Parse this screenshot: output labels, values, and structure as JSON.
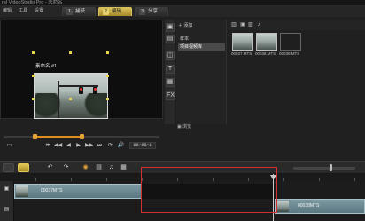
{
  "app": {
    "title": "rel VideoStudio Pro - 未命名"
  },
  "menu": [
    "编辑",
    "工具",
    "设置"
  ],
  "steps": [
    {
      "num": "1",
      "label": "捕获",
      "active": false
    },
    {
      "num": "2",
      "label": "编辑",
      "active": true
    },
    {
      "num": "3",
      "label": "分享",
      "active": false
    }
  ],
  "preview": {
    "clip_label": "素命名 #1"
  },
  "player": {
    "timecode": "00:00:0",
    "buttons": [
      "⏮",
      "◀◀",
      "◀",
      "▶",
      "▶▶",
      "⏭",
      "⟳",
      "🔊"
    ]
  },
  "library": {
    "add_label": "添加",
    "folders": [
      {
        "label": "样本",
        "selected": false
      },
      {
        "label": "项目视频库",
        "selected": true
      }
    ],
    "browse_label": "浏览",
    "thumbnails": [
      {
        "caption": "00037.MTS"
      },
      {
        "caption": "00038.MTS"
      },
      {
        "caption": "00039.MTS"
      }
    ]
  },
  "timeline": {
    "clips": [
      {
        "name": "00037MTS"
      },
      {
        "name": "00038MTS"
      }
    ]
  },
  "colors": {
    "accent": "#d6c15a",
    "selection": "#d03030",
    "clip": "#6c8a93"
  }
}
